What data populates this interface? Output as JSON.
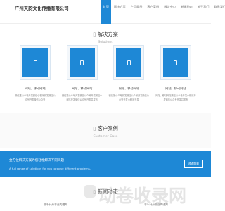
{
  "header": {
    "logo": "广州天韵文化传播有限公司",
    "nav": [
      "首页",
      "解决方案",
      "产品展示",
      "客户案例",
      "服务中心",
      "新闻动态",
      "关于我们",
      "联系我们"
    ],
    "active_index": 0
  },
  "solutions": {
    "title": "解决方案",
    "subtitle": "Solutions",
    "items": [
      {
        "title": "网站、移动网站",
        "desc": "微信推公众号开发微信小程序开发微信公众号开发微信公众号"
      },
      {
        "title": "网站、移动网站",
        "desc": "微信推公众号开发微信公众号开发微信小程序开发微信公众号开发并发布"
      },
      {
        "title": "网站、移动网站",
        "desc": "微信推公众号开发微信公众号开发微信公众号开发小程序开发"
      },
      {
        "title": "网站、移动网站",
        "desc": "网站、移动网站微信公众号开发小程序开发微信公众号开发并发布"
      }
    ]
  },
  "cases": {
    "title": "客户案例",
    "subtitle": "Customer Case"
  },
  "banner": {
    "main": "全方位解决方案为您轻松解决不同问题",
    "sub": "A full range of solutions for you to solve different problems.",
    "button": "咨询我们"
  },
  "news": {
    "title": "新闻动态",
    "items": [
      "非千开开非业的通知",
      "非千开开非业的通知"
    ]
  },
  "watermark": {
    "text": "动卷收录网"
  },
  "colors": {
    "accent": "#1e88d6"
  }
}
